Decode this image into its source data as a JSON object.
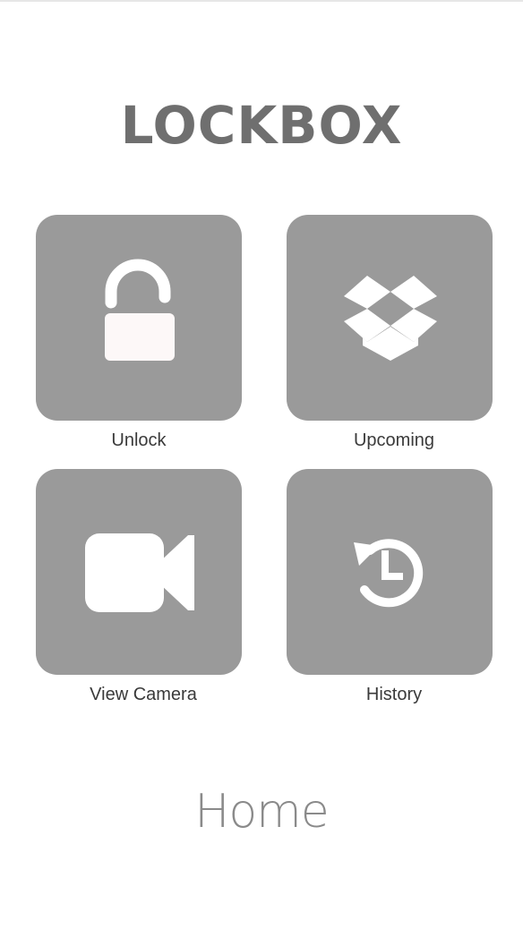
{
  "app": {
    "logo_text": "LOCKBOX",
    "page_title": "Home"
  },
  "tiles": [
    {
      "label": "Unlock",
      "icon": "unlock-icon"
    },
    {
      "label": "Upcoming",
      "icon": "dropbox-icon"
    },
    {
      "label": "View Camera",
      "icon": "video-camera-icon"
    },
    {
      "label": "History",
      "icon": "history-icon"
    }
  ],
  "colors": {
    "tile_background": "#9a9a9a",
    "icon_fill": "#ffffff",
    "logo_text": "#6f6f6f",
    "label_text": "#3a3a3a",
    "page_title": "#8a8a8a"
  }
}
